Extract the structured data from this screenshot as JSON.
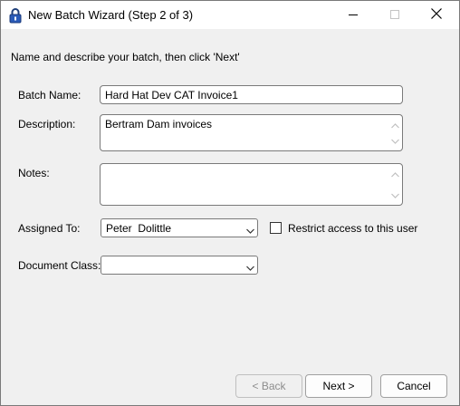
{
  "window": {
    "title": "New Batch Wizard (Step 2 of 3)",
    "controls": {
      "minimize_icon": "minimize-icon",
      "maximize_icon": "maximize-icon",
      "close_icon": "close-icon"
    }
  },
  "instructions": "Name and describe your batch, then click 'Next'",
  "form": {
    "batch_name": {
      "label": "Batch Name:",
      "value": "Hard Hat Dev CAT Invoice1"
    },
    "description": {
      "label": "Description:",
      "value": "Bertram Dam invoices"
    },
    "notes": {
      "label": "Notes:",
      "value": ""
    },
    "assigned_to": {
      "label": "Assigned To:",
      "value": "Peter  Dolittle"
    },
    "restrict_access": {
      "label": "Restrict access to this user",
      "checked": false
    },
    "document_class": {
      "label": "Document Class:",
      "value": ""
    }
  },
  "buttons": {
    "back": "< Back",
    "next": "Next >",
    "cancel": "Cancel"
  },
  "colors": {
    "title_bg": "#ffffff",
    "dialog_bg": "#f0f0f0",
    "field_border": "#7a7a7a",
    "disabled_text": "#8d8d8d"
  }
}
